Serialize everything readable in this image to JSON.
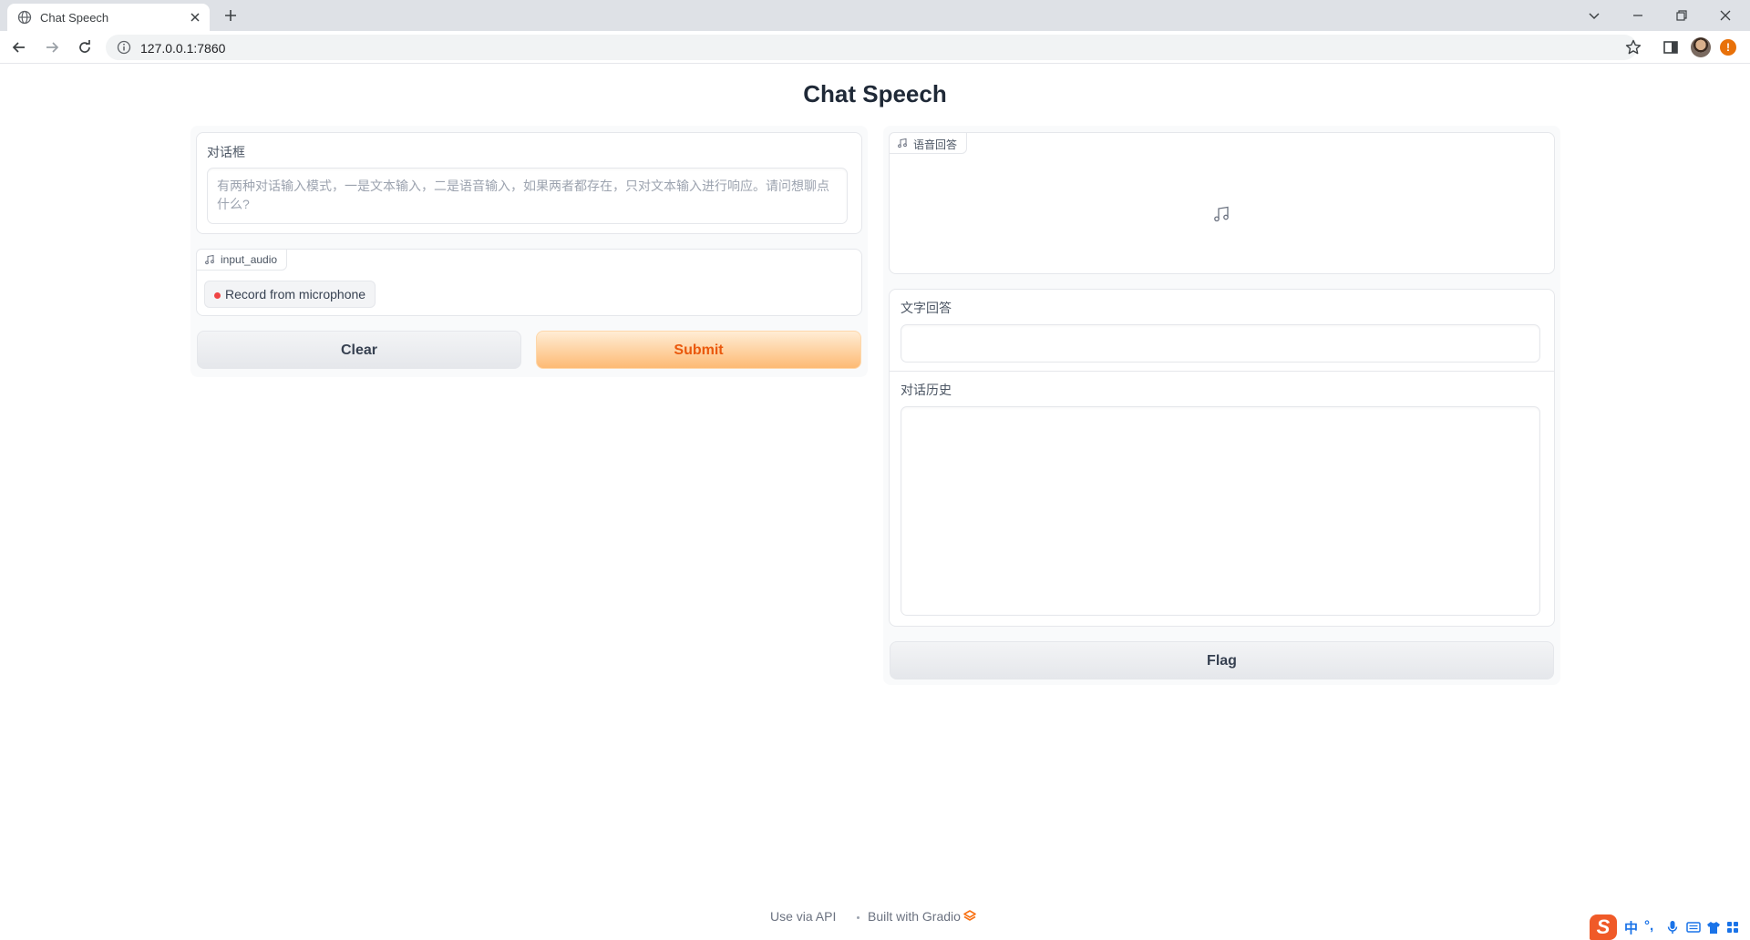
{
  "browser": {
    "tab_title": "Chat Speech",
    "url": "127.0.0.1:7860"
  },
  "app": {
    "title": "Chat Speech",
    "left": {
      "text_input": {
        "label": "对话框",
        "placeholder": "有两种对话输入模式，一是文本输入，二是语音输入，如果两者都存在，只对文本输入进行响应。请问想聊点什么?"
      },
      "audio_input": {
        "label": "input_audio",
        "record_label": "Record from microphone"
      },
      "clear_label": "Clear",
      "submit_label": "Submit"
    },
    "right": {
      "audio_output": {
        "label": "语音回答"
      },
      "text_output": {
        "label": "文字回答",
        "value": ""
      },
      "history": {
        "label": "对话历史",
        "value": ""
      },
      "flag_label": "Flag"
    }
  },
  "footer": {
    "api_label": "Use via API",
    "built_label": "Built with Gradio"
  },
  "ime": {
    "logo": "S",
    "lang": "中",
    "punct": "°,",
    "icons": [
      "microphone-icon",
      "keyboard-icon",
      "skin-icon",
      "apps-icon"
    ]
  },
  "colors": {
    "primary_gradient_top": "#ffedd5",
    "primary_gradient_bottom": "#fdba74",
    "primary_text": "#ea580c",
    "record_dot": "#ef4444",
    "ime_brand": "#f05a28"
  }
}
